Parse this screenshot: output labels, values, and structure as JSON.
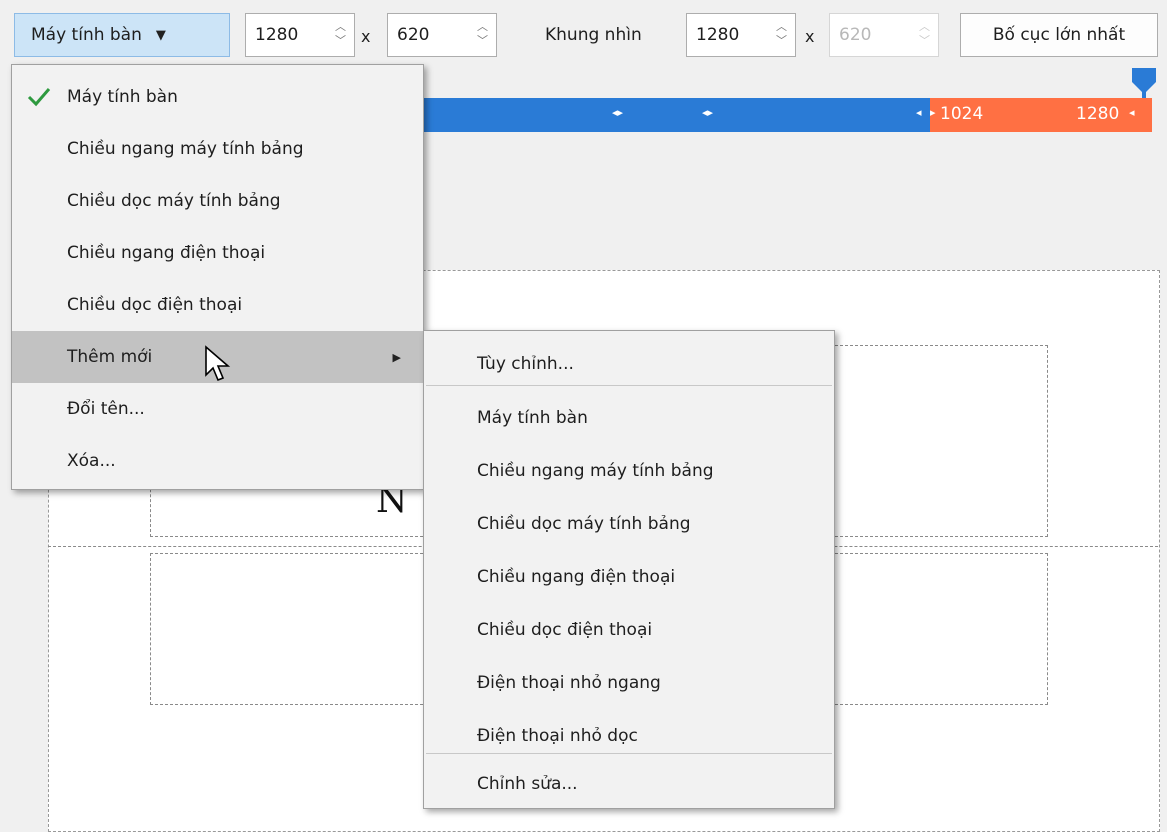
{
  "toolbar": {
    "device_dropdown_label": "Máy tính bàn",
    "width_value": "1280",
    "x_symbol": "x",
    "height_value": "620",
    "viewport_label": "Khung nhìn",
    "viewport_width": "1280",
    "viewport_height": "620",
    "largest_layout_button": "Bố cục lớn nhất"
  },
  "ruler": {
    "breakpoint_start": "1024",
    "breakpoint_end": "1280",
    "blue_color": "#2a7bd6",
    "orange_color": "#ff7043"
  },
  "canvas": {
    "visible_text": "N"
  },
  "device_menu": {
    "items": [
      {
        "label": "Máy tính bàn",
        "checked": true
      },
      {
        "label": "Chiều ngang máy tính bảng"
      },
      {
        "label": "Chiều dọc máy tính bảng"
      },
      {
        "label": "Chiều ngang điện thoại"
      },
      {
        "label": "Chiều dọc điện thoại"
      },
      {
        "label": "Thêm mới",
        "has_submenu": true,
        "highlighted": true
      },
      {
        "label": "Đổi tên..."
      },
      {
        "label": "Xóa..."
      }
    ]
  },
  "add_submenu": {
    "custom_label": "Tùy chỉnh...",
    "presets": [
      "Máy tính bàn",
      "Chiều ngang máy tính bảng",
      "Chiều dọc máy tính bảng",
      "Chiều ngang điện thoại",
      "Chiều dọc điện thoại",
      "Điện thoại nhỏ ngang",
      "Điện thoại nhỏ dọc"
    ],
    "edit_label": "Chỉnh sửa..."
  }
}
